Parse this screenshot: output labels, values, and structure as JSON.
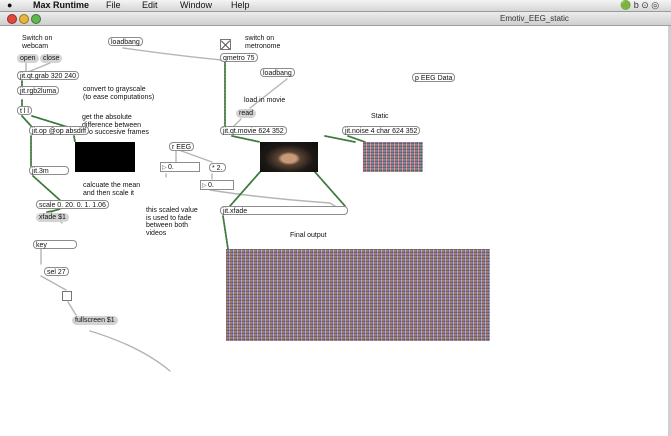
{
  "menubar": {
    "apple": "",
    "app": "Max Runtime",
    "menus": [
      "File",
      "Edit",
      "Window",
      "Help"
    ],
    "tray": "🟢 b ⊙ ◎"
  },
  "window": {
    "title": "Emotiv_EEG_static"
  },
  "objects": {
    "loadbang1": "loadbang",
    "open": "open",
    "close": "close",
    "metro": "qmetro 75",
    "loadbang2": "loadbang",
    "grab": "jit.qt.grab 320 240",
    "rgb2luma": "jit.rgb2luma",
    "peeg": "p EEG Data",
    "t": "t l l",
    "read": "read",
    "op": "jit.op @op absdiff",
    "movie": "jit.qt.movie 624 352",
    "noise": "jit.noise 4 char 624 352",
    "reeg": "r EEG",
    "mul": "* 2.",
    "num1": "0.",
    "num2": "0.",
    "jit3m": "jit.3m",
    "scale": "scale 0. 20. 0. 1. 1.06",
    "xfade": "jit.xfade",
    "xfademsg": "xfade $1",
    "key": "key",
    "sel": "sel 27",
    "fullscreen": "fullscreen $1"
  },
  "comments": {
    "switch_webcam": "Switch on\nwebcam",
    "switch_metro": "switch on\nmetronome",
    "grayscale": "convert to grayscale\n(to ease computations)",
    "loadmovie": "load in movie",
    "static": "Static",
    "absdiff": "get the absolute\ndifference between\ntwo succesive frames",
    "mean": "calcuate the mean\nand then scale it",
    "fade": "this scaled value\nis used to fade\nbetween both\nvideos",
    "final": "Final output"
  }
}
